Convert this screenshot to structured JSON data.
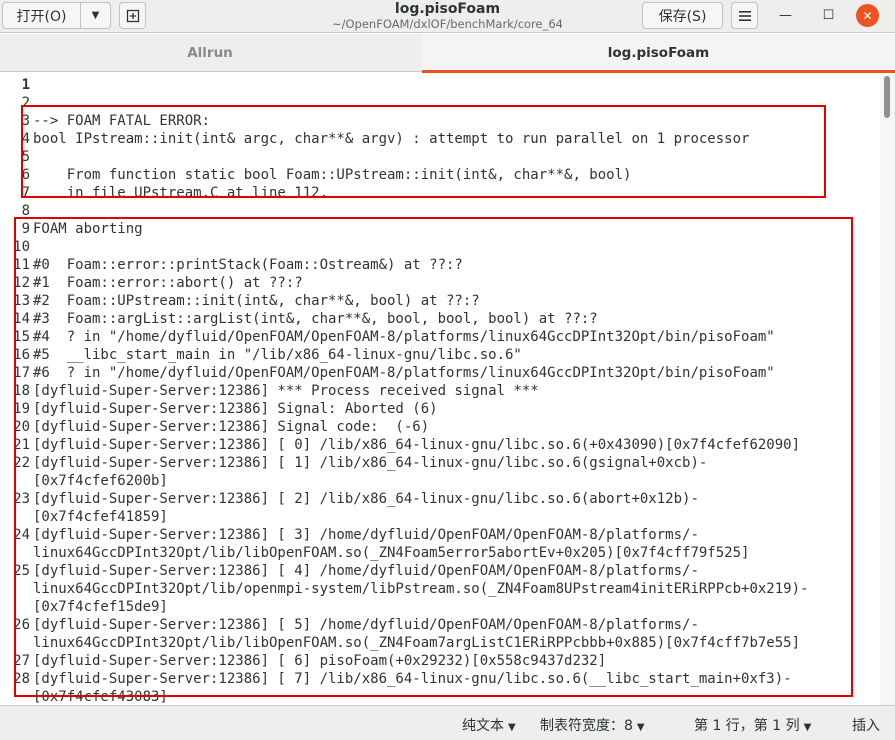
{
  "header": {
    "open_label": "打开(O)",
    "open_menu_icon": "chevron-down-icon",
    "new_tab_icon": "new-tab-icon",
    "title": "log.pisoFoam",
    "subtitle": "~/OpenFOAM/dxlOF/benchMark/core_64",
    "save_label": "保存(S)",
    "menu_icon": "hamburger-icon",
    "minimize_glyph": "—",
    "maximize_glyph": "☐",
    "close_glyph": "✕"
  },
  "tabs": [
    {
      "label": "Allrun",
      "active": false
    },
    {
      "label": "log.pisoFoam",
      "active": true
    }
  ],
  "editor": {
    "accent": "#e95420",
    "highlight_color": "#e00000",
    "lines": [
      {
        "n": "1",
        "text": ""
      },
      {
        "n": "2",
        "text": ""
      },
      {
        "n": "3",
        "text": "--> FOAM FATAL ERROR:"
      },
      {
        "n": "4",
        "text": "bool IPstream::init(int& argc, char**& argv) : attempt to run parallel on 1 processor"
      },
      {
        "n": "5",
        "text": ""
      },
      {
        "n": "6",
        "text": "    From function static bool Foam::UPstream::init(int&, char**&, bool)"
      },
      {
        "n": "7",
        "text": "    in file UPstream.C at line 112."
      },
      {
        "n": "8",
        "text": ""
      },
      {
        "n": "9",
        "text": "FOAM aborting"
      },
      {
        "n": "10",
        "text": ""
      },
      {
        "n": "11",
        "text": "#0  Foam::error::printStack(Foam::Ostream&) at ??:?"
      },
      {
        "n": "12",
        "text": "#1  Foam::error::abort() at ??:?"
      },
      {
        "n": "13",
        "text": "#2  Foam::UPstream::init(int&, char**&, bool) at ??:?"
      },
      {
        "n": "14",
        "text": "#3  Foam::argList::argList(int&, char**&, bool, bool, bool) at ??:?"
      },
      {
        "n": "15",
        "text": "#4  ? in \"/home/dyfluid/OpenFOAM/OpenFOAM-8/platforms/linux64GccDPInt32Opt/bin/pisoFoam\""
      },
      {
        "n": "16",
        "text": "#5  __libc_start_main in \"/lib/x86_64-linux-gnu/libc.so.6\""
      },
      {
        "n": "17",
        "text": "#6  ? in \"/home/dyfluid/OpenFOAM/OpenFOAM-8/platforms/linux64GccDPInt32Opt/bin/pisoFoam\""
      },
      {
        "n": "18",
        "text": "[dyfluid-Super-Server:12386] *** Process received signal ***"
      },
      {
        "n": "19",
        "text": "[dyfluid-Super-Server:12386] Signal: Aborted (6)"
      },
      {
        "n": "20",
        "text": "[dyfluid-Super-Server:12386] Signal code:  (-6)"
      },
      {
        "n": "21",
        "text": "[dyfluid-Super-Server:12386] [ 0] /lib/x86_64-linux-gnu/libc.so.6(+0x43090)[0x7f4cfef62090]"
      },
      {
        "n": "22",
        "text": "[dyfluid-Super-Server:12386] [ 1] /lib/x86_64-linux-gnu/libc.so.6(gsignal+0xcb)-"
      },
      {
        "n": "",
        "text": "[0x7f4cfef6200b]"
      },
      {
        "n": "23",
        "text": "[dyfluid-Super-Server:12386] [ 2] /lib/x86_64-linux-gnu/libc.so.6(abort+0x12b)-"
      },
      {
        "n": "",
        "text": "[0x7f4cfef41859]"
      },
      {
        "n": "24",
        "text": "[dyfluid-Super-Server:12386] [ 3] /home/dyfluid/OpenFOAM/OpenFOAM-8/platforms/-"
      },
      {
        "n": "",
        "text": "linux64GccDPInt32Opt/lib/libOpenFOAM.so(_ZN4Foam5error5abortEv+0x205)[0x7f4cff79f525]"
      },
      {
        "n": "25",
        "text": "[dyfluid-Super-Server:12386] [ 4] /home/dyfluid/OpenFOAM/OpenFOAM-8/platforms/-"
      },
      {
        "n": "",
        "text": "linux64GccDPInt32Opt/lib/openmpi-system/libPstream.so(_ZN4Foam8UPstream4initERiRPPcb+0x219)-"
      },
      {
        "n": "",
        "text": "[0x7f4cfef15de9]"
      },
      {
        "n": "26",
        "text": "[dyfluid-Super-Server:12386] [ 5] /home/dyfluid/OpenFOAM/OpenFOAM-8/platforms/-"
      },
      {
        "n": "",
        "text": "linux64GccDPInt32Opt/lib/libOpenFOAM.so(_ZN4Foam7argListC1ERiRPPcbbb+0x885)[0x7f4cff7b7e55]"
      },
      {
        "n": "27",
        "text": "[dyfluid-Super-Server:12386] [ 6] pisoFoam(+0x29232)[0x558c9437d232]"
      },
      {
        "n": "28",
        "text": "[dyfluid-Super-Server:12386] [ 7] /lib/x86_64-linux-gnu/libc.so.6(__libc_start_main+0xf3)-"
      },
      {
        "n": "",
        "text": "[0x7f4cfef43083]"
      }
    ]
  },
  "statusbar": {
    "language": "纯文本",
    "tab_width": "制表符宽度：8",
    "position": "第 1 行，第 1 列",
    "mode": "插入"
  }
}
